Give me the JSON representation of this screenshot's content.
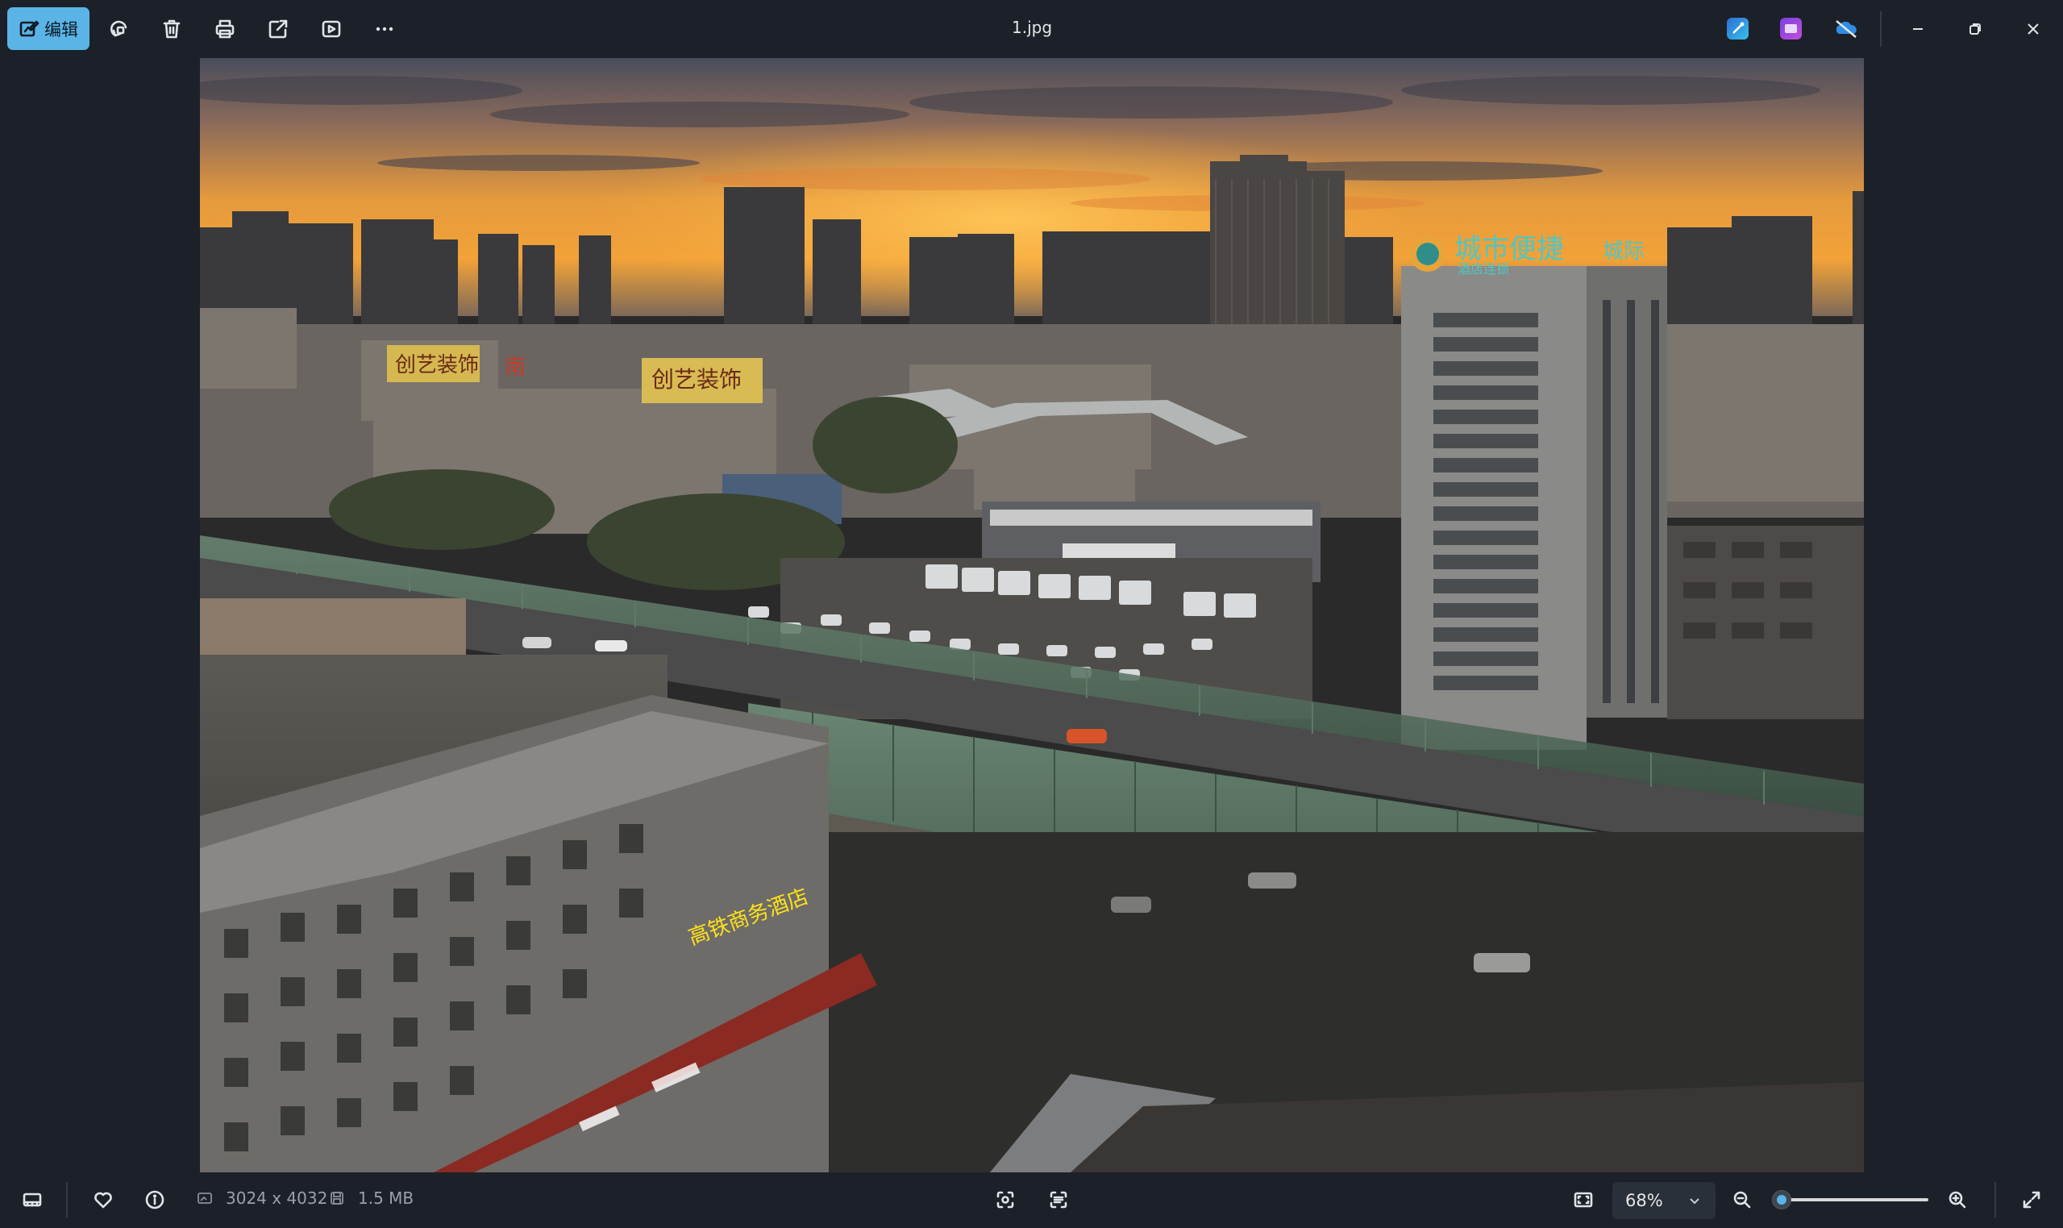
{
  "window": {
    "title": "1.jpg"
  },
  "toolbar": {
    "edit_label": "编辑",
    "icons": [
      "edit-icon",
      "rotate-icon",
      "delete-icon",
      "print-icon",
      "share-icon",
      "slideshow-icon",
      "more-icon"
    ]
  },
  "titlebar_apps": [
    "clipchamp-icon",
    "designer-icon",
    "onedrive-icon"
  ],
  "window_controls": [
    "minimize-icon",
    "restore-icon",
    "close-icon"
  ],
  "photo": {
    "signs": {
      "hotel_name": "城市便捷",
      "hotel_sub": "酒店连锁",
      "hotel_brand": "城际",
      "billboard_left": "创艺装饰",
      "billboard_right": "创艺装饰",
      "neon": "高铁商务酒店",
      "building_red": "南"
    }
  },
  "statusbar": {
    "dimensions": "3024 x 4032",
    "file_size": "1.5 MB",
    "zoom": "68%",
    "zoom_level": 0.68
  },
  "colors": {
    "background": "#1c2129",
    "accent": "#5ab4e6"
  }
}
